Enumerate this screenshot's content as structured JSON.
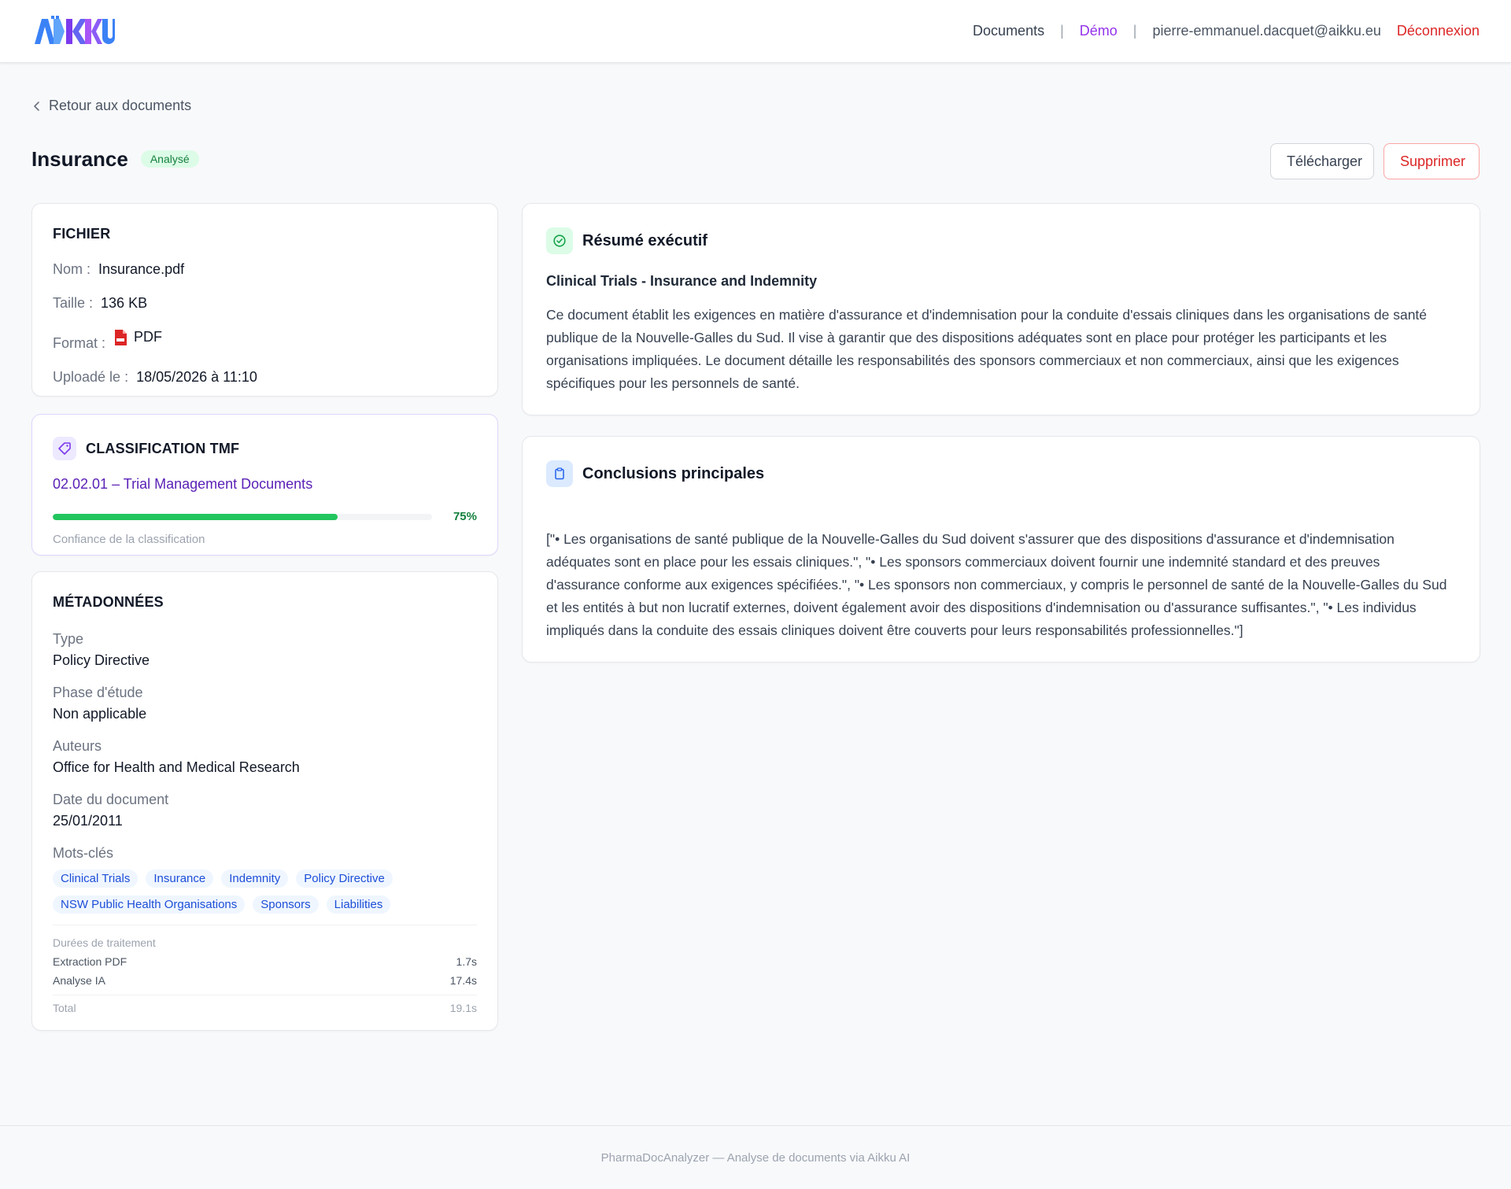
{
  "header": {
    "logo_text": "AIKKU",
    "nav": {
      "documents": "Documents",
      "demo": "Démo",
      "email": "pierre-emmanuel.dacquet@aikku.eu",
      "logout": "Déconnexion",
      "separator": "|"
    }
  },
  "back_link": "Retour aux documents",
  "document": {
    "title": "Insurance",
    "status": "Analysé",
    "download_label": "Télécharger",
    "delete_label": "Supprimer"
  },
  "file": {
    "section_title": "FICHIER",
    "name_label": "Nom :",
    "name": "Insurance.pdf",
    "size_label": "Taille :",
    "size": "136 KB",
    "format_label": "Format :",
    "format": "PDF",
    "format_icon": "pdf-file-icon",
    "uploaded_label": "Uploadé le :",
    "uploaded": "18/05/2026 à 11:10"
  },
  "tmf": {
    "section_title": "CLASSIFICATION TMF",
    "icon": "tag-icon",
    "code": "02.02.01 – Trial Management Documents",
    "confidence": 0.75,
    "confidence_label": "75%",
    "confidence_caption": "Confiance de la classification"
  },
  "metadata": {
    "section_title": "MÉTADONNÉES",
    "type_label": "Type",
    "type": "Policy Directive",
    "phase_label": "Phase d'étude",
    "phase": "Non applicable",
    "authors_label": "Auteurs",
    "authors": "Office for Health and Medical Research",
    "date_label": "Date du document",
    "date": "25/01/2011",
    "keywords_label": "Mots-clés",
    "keywords": [
      "Clinical Trials",
      "Insurance",
      "Indemnity",
      "Policy Directive",
      "NSW Public Health Organisations",
      "Sponsors",
      "Liabilities"
    ],
    "timings": {
      "title": "Durées de traitement",
      "pdf_label": "Extraction PDF",
      "pdf": "1.7s",
      "ai_label": "Analyse IA",
      "ai": "17.4s",
      "total_label": "Total",
      "total": "19.1s"
    }
  },
  "summary": {
    "title": "Résumé exécutif",
    "icon": "check-circle-icon",
    "subtitle": "Clinical Trials - Insurance and Indemnity",
    "text": "Ce document établit les exigences en matière d'assurance et d'indemnisation pour la conduite d'essais cliniques dans les organisations de santé publique de la Nouvelle-Galles du Sud. Il vise à garantir que des dispositions adéquates sont en place pour protéger les participants et les organisations impliquées. Le document détaille les responsabilités des sponsors commerciaux et non commerciaux, ainsi que les exigences spécifiques pour les personnels de santé."
  },
  "conclusions": {
    "title": "Conclusions principales",
    "icon": "clipboard-icon",
    "text": "[\"• Les organisations de santé publique de la Nouvelle-Galles du Sud doivent s'assurer que des dispositions d'assurance et d'indemnisation adéquates sont en place pour les essais cliniques.\", \"• Les sponsors commerciaux doivent fournir une indemnité standard et des preuves d'assurance conforme aux exigences spécifiées.\", \"• Les sponsors non commerciaux, y compris le personnel de santé de la Nouvelle-Galles du Sud et les entités à but non lucratif externes, doivent également avoir des dispositions d'indemnisation ou d'assurance suffisantes.\", \"• Les individus impliqués dans la conduite des essais cliniques doivent être couverts pour leurs responsabilités professionnelles.\"]"
  },
  "footer": "PharmaDocAnalyzer — Analyse de documents via Aikku AI",
  "colors": {
    "accent_purple": "#9333ea",
    "logout_red": "#dc2626",
    "progress_green": "#22c55e",
    "tag_blue": "#1d4ed8"
  }
}
